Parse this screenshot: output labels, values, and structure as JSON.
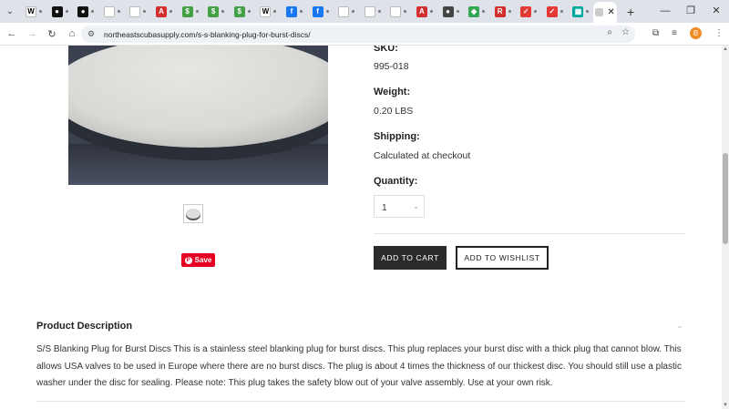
{
  "browser": {
    "tabs": [
      {
        "icon": "W",
        "color": "#ffffff",
        "fg": "#000"
      },
      {
        "icon": "●",
        "color": "#111111",
        "fg": "#fff"
      },
      {
        "icon": "●",
        "color": "#111111",
        "fg": "#fff"
      },
      {
        "icon": "",
        "color": "#ffffff",
        "fg": "#000"
      },
      {
        "icon": "",
        "color": "#ffffff",
        "fg": "#000"
      },
      {
        "icon": "A",
        "color": "#d32f2f",
        "fg": "#fff"
      },
      {
        "icon": "$",
        "color": "#43a047",
        "fg": "#fff"
      },
      {
        "icon": "$",
        "color": "#43a047",
        "fg": "#fff"
      },
      {
        "icon": "$",
        "color": "#43a047",
        "fg": "#fff"
      },
      {
        "icon": "W",
        "color": "#ffffff",
        "fg": "#000"
      },
      {
        "icon": "f",
        "color": "#1877f2",
        "fg": "#fff"
      },
      {
        "icon": "f",
        "color": "#1877f2",
        "fg": "#fff"
      },
      {
        "icon": "",
        "color": "#ffffff",
        "fg": "#000"
      },
      {
        "icon": "",
        "color": "#ffffff",
        "fg": "#000"
      },
      {
        "icon": "",
        "color": "#ffffff",
        "fg": "#000"
      },
      {
        "icon": "A",
        "color": "#d32f2f",
        "fg": "#fff"
      },
      {
        "icon": "●",
        "color": "#444444",
        "fg": "#fff"
      },
      {
        "icon": "◆",
        "color": "#34a853",
        "fg": "#fff"
      },
      {
        "icon": "R",
        "color": "#d32f2f",
        "fg": "#fff"
      },
      {
        "icon": "✓",
        "color": "#e53935",
        "fg": "#fff"
      },
      {
        "icon": "✓",
        "color": "#e53935",
        "fg": "#fff"
      },
      {
        "icon": "▦",
        "color": "#00a99d",
        "fg": "#fff"
      }
    ],
    "url": "northeastscubasupply.com/s-s-blanking-plug-for-burst-discs/",
    "profile_initial": "B"
  },
  "product": {
    "sku_label": "SKU:",
    "sku_value": "995-018",
    "weight_label": "Weight:",
    "weight_value": "0.20 LBS",
    "shipping_label": "Shipping:",
    "shipping_value": "Calculated at checkout",
    "quantity_label": "Quantity:",
    "quantity_value": "1",
    "add_to_cart": "ADD TO CART",
    "add_to_wishlist": "ADD TO WISHLIST",
    "pin_save": "Save"
  },
  "description": {
    "title": "Product Description",
    "text": "S/S Blanking Plug for Burst Discs     This is a stainless steel blanking plug for burst discs.  This plug replaces your burst disc with a thick plug that cannot blow.  This allows USA valves to be used in Europe where there are no burst discs. The plug is about 4 times the thickness of our thickest disc. You should still use a plastic washer under the disc for sealing.   Please note:  This plug takes the safety blow out of your valve assembly. Use at your own risk."
  }
}
